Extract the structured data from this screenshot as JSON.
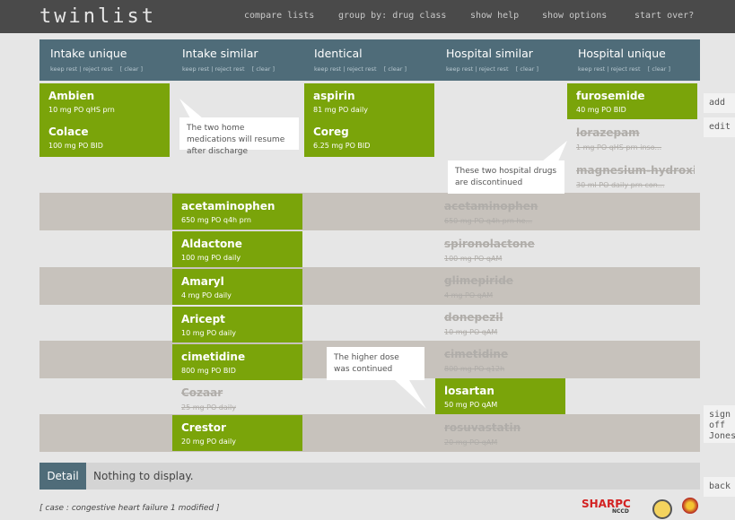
{
  "app": {
    "name": "twinlist"
  },
  "topnav": [
    "compare lists",
    "group by: drug class",
    "show help",
    "show options",
    "start over?"
  ],
  "columns": [
    {
      "title": "Intake unique",
      "actions": "keep rest | reject rest",
      "clear": "[ clear ]"
    },
    {
      "title": "Intake similar",
      "actions": "keep rest | reject rest",
      "clear": "[ clear ]"
    },
    {
      "title": "Identical",
      "actions": "keep rest | reject rest",
      "clear": "[ clear ]"
    },
    {
      "title": "Hospital similar",
      "actions": "keep rest | reject rest",
      "clear": "[ clear ]"
    },
    {
      "title": "Hospital unique",
      "actions": "keep rest | reject rest",
      "clear": "[ clear ]"
    }
  ],
  "meds": {
    "ambien": {
      "name": "Ambien",
      "detail": "10 mg  PO  qHS prn"
    },
    "colace": {
      "name": "Colace",
      "detail": "100 mg  PO  BID"
    },
    "aspirin": {
      "name": "aspirin",
      "detail": "81 mg  PO  daily"
    },
    "coreg": {
      "name": "Coreg",
      "detail": "6.25 mg  PO  BID"
    },
    "furosemide": {
      "name": "furosemide",
      "detail": "40 mg  PO  BID"
    },
    "lorazepam": {
      "name": "lorazepam",
      "detail": "1 mg  PO  qHS prn inso..."
    },
    "magnesium": {
      "name": "magnesium-hydroxi...",
      "detail": "30 ml  PO  daily prn con..."
    },
    "acetaminophen": {
      "name": "acetaminophen",
      "detail": "650 mg  PO  q4h prn"
    },
    "acetaminophen_h": {
      "name": "acetaminophen",
      "detail": "650 mg  PO  q4h prn he..."
    },
    "aldactone": {
      "name": "Aldactone",
      "detail": "100 mg  PO  daily"
    },
    "spironolactone": {
      "name": "spironolactone",
      "detail": "100 mg  PO  qAM"
    },
    "amaryl": {
      "name": "Amaryl",
      "detail": "4 mg  PO  daily"
    },
    "glimepiride": {
      "name": "glimepiride",
      "detail": "4 mg  PO  qAM"
    },
    "aricept": {
      "name": "Aricept",
      "detail": "10 mg  PO  daily"
    },
    "donepezil": {
      "name": "donepezil",
      "detail": "10 mg  PO  qAM"
    },
    "cimetidine": {
      "name": "cimetidine",
      "detail": "800 mg  PO  BID"
    },
    "cimetidine_h": {
      "name": "cimetidine",
      "detail": "800 mg  PO  q12h"
    },
    "cozaar": {
      "name": "Cozaar",
      "detail": "25 mg  PO  daily"
    },
    "losartan": {
      "name": "losartan",
      "detail": "50 mg  PO  qAM"
    },
    "crestor": {
      "name": "Crestor",
      "detail": "20 mg  PO  daily"
    },
    "rosuvastatin": {
      "name": "rosuvastatin",
      "detail": "20 mg  PO  qAM"
    }
  },
  "bubbles": {
    "home": "The two home medications will resume after discharge",
    "hospital": "These two hospital drugs are discontinued",
    "dose": "The higher dose was continued"
  },
  "side": {
    "add": "add",
    "edit": "edit",
    "signoff": "sign off",
    "user": "Jones,",
    "back": "back"
  },
  "detail": {
    "button": "Detail",
    "text": "Nothing to display."
  },
  "footer": {
    "case": "[ case : congestive heart failure 1 modified ]",
    "logo_text": "SHARPC",
    "logo_sub": "NCCD"
  },
  "colors": {
    "green": "#7aa40a",
    "header": "#4f6c79",
    "band": "#c7c2bc",
    "topbar": "#4a4a4a"
  }
}
